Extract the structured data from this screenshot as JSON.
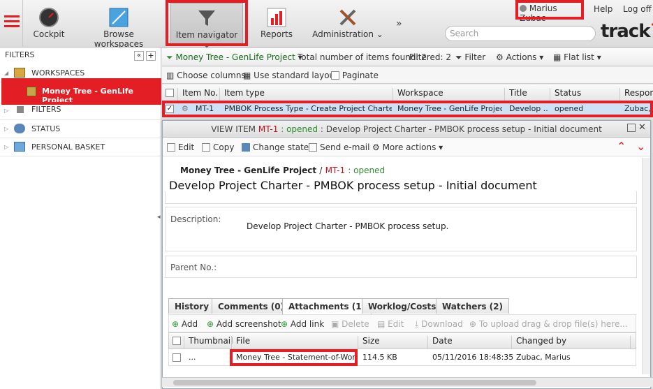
{
  "topbar": {
    "nav": [
      {
        "label": "Cockpit",
        "icon": "gauge-icon"
      },
      {
        "label": "Browse workspaces",
        "icon": "workspace-icon"
      },
      {
        "label": "Item navigator",
        "icon": "funnel-icon"
      },
      {
        "label": "Reports",
        "icon": "bar-chart-icon"
      },
      {
        "label": "Administration",
        "icon": "tools-icon"
      }
    ],
    "more": "»",
    "user": "Marius Zubac",
    "help": "Help",
    "logoff": "Log off",
    "search_placeholder": "Search",
    "logo": "track",
    "logo_plus": "+"
  },
  "left": {
    "header": "FILTERS",
    "collapse": "«",
    "add": "+",
    "tree": [
      {
        "label": "WORKSPACES"
      },
      {
        "label": "Money Tree - GenLife Project"
      },
      {
        "label": "FILTERS"
      },
      {
        "label": "STATUS"
      },
      {
        "label": "PERSONAL BASKET"
      }
    ]
  },
  "toolbar1": {
    "project": "Money Tree - GenLife Project",
    "total": "Total number of items found: 2",
    "filtered": "Filtered: 2",
    "filter": "Filter",
    "actions": "Actions",
    "flat_list": "Flat list"
  },
  "toolbar2": {
    "choose_columns": "Choose columns",
    "standard_layout": "Use standard layout",
    "paginate": "Paginate"
  },
  "grid": {
    "headers": [
      "Item No.",
      "Item type",
      "Workspace",
      "Title",
      "Status",
      "Respons"
    ],
    "row": [
      "MT-1",
      "PMBOK Process Type - Create Project Charter",
      "Money Tree - GenLife Project",
      "Develop ...",
      "opened",
      "Zubac, M"
    ]
  },
  "dialog": {
    "title_prefix": "VIEW ITEM",
    "item_id": "MT-1",
    "title_status": ": opened",
    "title_rest": ": Develop Project Charter - PMBOK process setup - Initial document",
    "tools": [
      "Edit",
      "Copy",
      "Change state",
      "Send e-mail",
      "More actions"
    ],
    "workspace": "Money Tree - GenLife Project",
    "sep": "/",
    "status": ": opened",
    "heading": "Develop Project Charter - PMBOK process setup - Initial document",
    "desc_label": "Description:",
    "desc_value": "Develop Project Charter - PMBOK process setup.",
    "parent_label": "Parent No.:",
    "tabs": [
      "History",
      "Comments (0)",
      "Attachments (1)",
      "Worklog/Costs",
      "Watchers (2)"
    ],
    "att_tools": [
      "Add",
      "Add screenshot",
      "Add link",
      "Delete",
      "Edit",
      "Download",
      "To upload drag & drop file(s) here..."
    ],
    "att_headers": [
      "Thumbnail",
      "File",
      "Size",
      "Date",
      "Changed by"
    ],
    "att_row": [
      "...",
      "Money Tree - Statement-of-Work...",
      "114.5 KB",
      "05/11/2016 18:48:35",
      "Zubac, Marius"
    ]
  },
  "colors": {
    "accent_red": "#e31e24",
    "selection_blue": "#cfe2f5",
    "status_green": "#2e8b2e"
  }
}
